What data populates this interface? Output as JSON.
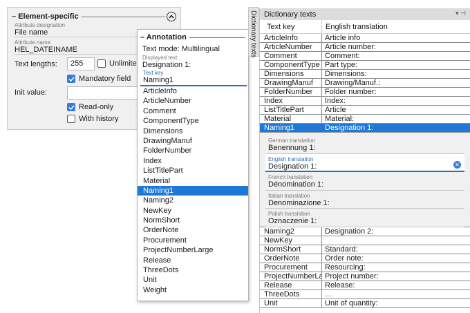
{
  "element_specific": {
    "title": "– Element-specific",
    "attr_designation": {
      "caption": "Attribute designation",
      "value": "File name"
    },
    "attr_name": {
      "caption": "Attribute name",
      "value": "HEL_DATEINAME"
    },
    "text_lengths_label": "Text lengths:",
    "text_lengths_value": "255",
    "unlimited_label": "Unlimited",
    "mandatory_label": "Mandatory field",
    "init_value_label": "Init value:",
    "readonly_label": "Read-only",
    "history_label": "With history"
  },
  "annotation": {
    "title": "– Annotation",
    "text_mode": "Text mode: Multilingual",
    "displayed_caption": "Displayed text",
    "displayed_value": "Designation 1:",
    "key_caption": "Text key",
    "key_value": "Naming1",
    "selected_index": 10,
    "keys": [
      "ArticleInfo",
      "ArticleNumber",
      "Comment",
      "ComponentType",
      "Dimensions",
      "DrawingManuf",
      "FolderNumber",
      "Index",
      "ListTitlePart",
      "Material",
      "Naming1",
      "Naming2",
      "NewKey",
      "NormShort",
      "OrderNote",
      "Procurement",
      "ProjectNumberLarge",
      "Release",
      "ThreeDots",
      "Unit",
      "Weight"
    ]
  },
  "dictionary": {
    "tab_label": "Dictionary texts",
    "title": "Dictionary texts",
    "header": {
      "key": "Text key",
      "translation": "English translation"
    },
    "rows_before": [
      {
        "key": "ArticleInfo",
        "value": "Article info"
      },
      {
        "key": "ArticleNumber",
        "value": "Article number:"
      },
      {
        "key": "Comment",
        "value": "Comment:"
      },
      {
        "key": "ComponentType",
        "value": "Part type:"
      },
      {
        "key": "Dimensions",
        "value": "Dimensions:"
      },
      {
        "key": "DrawingManuf",
        "value": "Drawing/Manuf.:"
      },
      {
        "key": "FolderNumber",
        "value": "Folder number:"
      },
      {
        "key": "Index",
        "value": "Index:"
      },
      {
        "key": "ListTitlePart",
        "value": "Article"
      },
      {
        "key": "Material",
        "value": "Material:"
      }
    ],
    "selected_row": {
      "key": "Naming1",
      "value": "Designation 1:"
    },
    "translations": [
      {
        "caption": "German translation",
        "value": "Benennung 1:"
      },
      {
        "caption": "English translation",
        "value": "Designation 1:"
      },
      {
        "caption": "French translation",
        "value": "Dénomination 1:"
      },
      {
        "caption": "Italian translation",
        "value": "Denominazione 1:"
      },
      {
        "caption": "Polish translation",
        "value": "Oznaczenie 1:"
      }
    ],
    "rows_after": [
      {
        "key": "Naming2",
        "value": "Designation 2:"
      },
      {
        "key": "NewKey",
        "value": ""
      },
      {
        "key": "NormShort",
        "value": "Standard:"
      },
      {
        "key": "OrderNote",
        "value": "Order note:"
      },
      {
        "key": "Procurement",
        "value": "Resourcing:"
      },
      {
        "key": "ProjectNumberLarge",
        "value": "Project number:"
      },
      {
        "key": "Release",
        "value": "Release:"
      },
      {
        "key": "ThreeDots",
        "value": "..."
      },
      {
        "key": "Unit",
        "value": "Unit of quantity:"
      }
    ]
  }
}
